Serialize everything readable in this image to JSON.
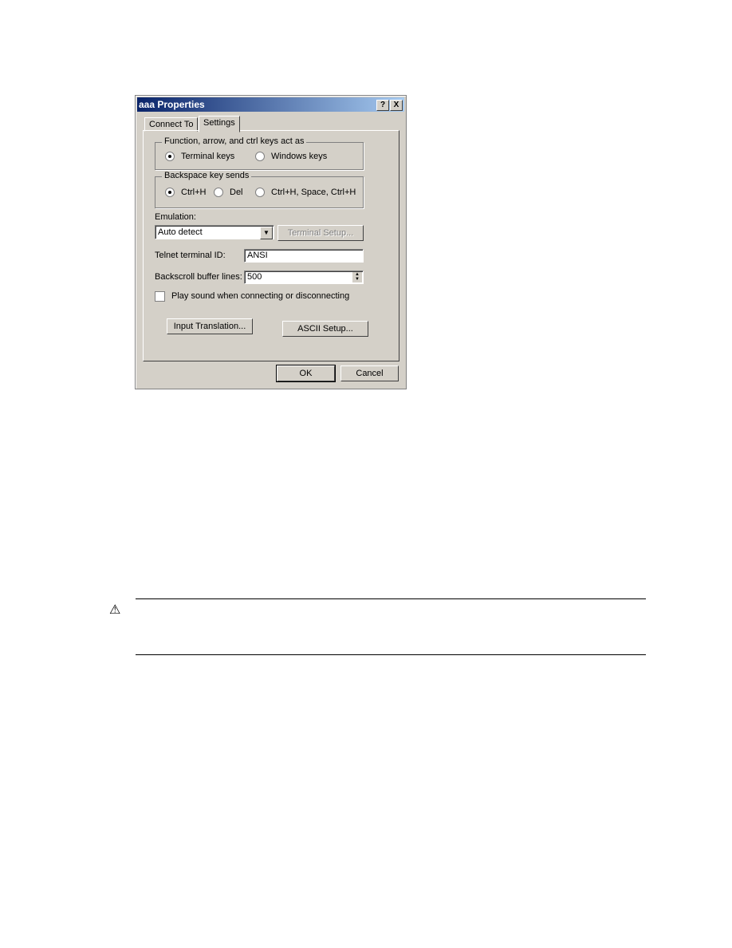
{
  "dialog": {
    "title": "aaa Properties",
    "help_button": "?",
    "close_button": "X",
    "tabs": [
      {
        "label": "Connect To",
        "active": false
      },
      {
        "label": "Settings",
        "active": true
      }
    ],
    "keys_group": {
      "legend": "Function, arrow, and ctrl keys act as",
      "options": [
        {
          "label": "Terminal keys",
          "selected": true
        },
        {
          "label": "Windows keys",
          "selected": false
        }
      ]
    },
    "backspace_group": {
      "legend": "Backspace key sends",
      "options": [
        {
          "label": "Ctrl+H",
          "selected": true
        },
        {
          "label": "Del",
          "selected": false
        },
        {
          "label": "Ctrl+H, Space, Ctrl+H",
          "selected": false
        }
      ]
    },
    "emulation": {
      "label": "Emulation:",
      "value": "Auto detect",
      "terminal_setup": "Terminal Setup..."
    },
    "telnet_id": {
      "label": "Telnet terminal ID:",
      "value": "ANSI"
    },
    "backscroll": {
      "label": "Backscroll buffer lines:",
      "value": "500"
    },
    "play_sound": {
      "label": "Play sound when connecting or disconnecting",
      "checked": false
    },
    "input_translation": "Input Translation...",
    "ascii_setup": "ASCII Setup...",
    "ok": "OK",
    "cancel": "Cancel"
  },
  "colors": {
    "title_start": "#0a246a",
    "title_end": "#a6caf0",
    "face": "#d4d0c8"
  },
  "warning": {
    "icon": "warning-triangle-icon"
  }
}
